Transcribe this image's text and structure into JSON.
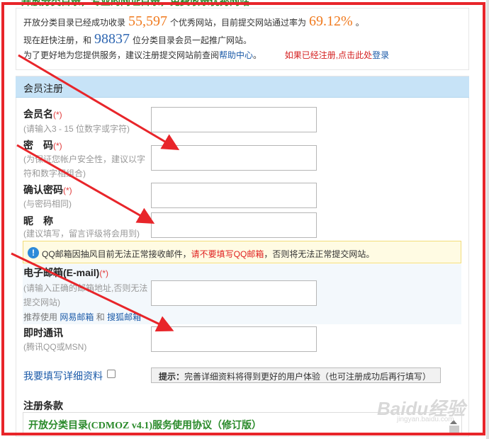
{
  "top_banner": "开放分类目录，专业的网址目录，免费收录优秀网站",
  "stats": {
    "prefix": "开放分类目录已经成功收录",
    "site_count": "55,597",
    "middle": "个优秀网站，目前提交网站通过率为",
    "pass_rate": "69.12%",
    "suffix": "。",
    "join_prefix": "现在赶快注册，和",
    "member_count": "98837",
    "join_suffix": "位分类目录会员一起推广网站。",
    "service_text": "为了更好地为您提供服务，建议注册提交网站前查阅",
    "help_link": "帮助中心",
    "service_end": "。",
    "registered_text": "如果已经注册,点击此处",
    "login_link": "登录"
  },
  "form": {
    "title": "会员注册",
    "required_mark": "(*)",
    "username": {
      "label": "会员名",
      "hint": "(请输入3 - 15 位数字或字符)"
    },
    "password": {
      "label": "密　码",
      "hint1": "(为保证您帐户安全性，建议以字",
      "hint2": "符和数字相组合)"
    },
    "confirm": {
      "label": "确认密码",
      "hint": "(与密码相同)"
    },
    "nickname": {
      "label": "昵　称",
      "hint": "(建议填写，留言评级将会用到)"
    },
    "warning": {
      "icon": "info-icon",
      "text_before": "QQ邮箱因抽风目前无法正常接收邮件，",
      "text_red": "请不要填写QQ邮箱",
      "text_after": "，否则将无法正常提交网站。"
    },
    "email": {
      "label": "电子邮箱(E-mail)",
      "hint1": "(请输入正确的邮箱地址,否则无法",
      "hint2": "提交网站)",
      "recommend_prefix": "推荐使用",
      "link1": "网易邮箱",
      "and": "和",
      "link2": "搜狐邮箱"
    },
    "im": {
      "label": "即时通讯",
      "hint": "(腾讯QQ或MSN)"
    },
    "detail_toggle": "我要填写详细资料",
    "tip_bold": "提示：",
    "tip_text": "完善详细资料将得到更好的用户体验（也可注册成功后再行填写）",
    "terms_label": "注册条款",
    "terms_title": "开放分类目录(CDMOZ v4.1)服务使用协议（修订版）"
  },
  "watermark": {
    "main": "Baidu经验",
    "sub": "jingyan.baidu.com"
  },
  "colors": {
    "annotation_red": "#e8252a",
    "header_blue": "#c7e3f7",
    "orange": "#f07a1e",
    "link_blue": "#1b5aa8"
  }
}
